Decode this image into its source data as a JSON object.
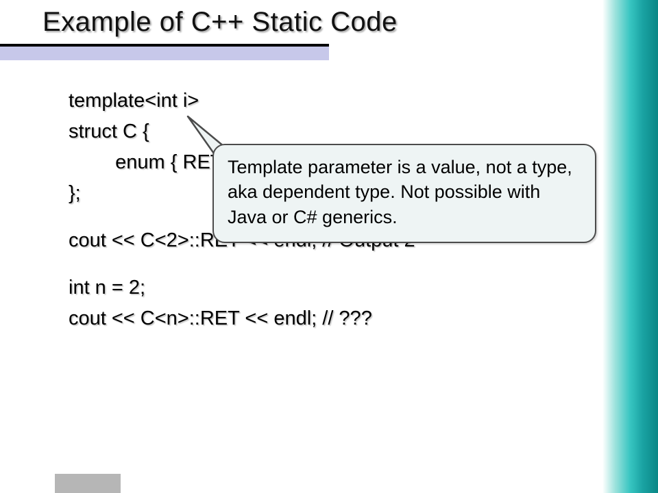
{
  "title": "Example of C++ Static Code",
  "code": {
    "l1": "template<int i>",
    "l2": "struct C {",
    "l3": "   enum { RET = i };",
    "l4": "};",
    "l5": "cout << C<2>::RET << endl; // Output 2",
    "l6": "int n = 2;",
    "l7": "cout << C<n>::RET << endl; // ???"
  },
  "callout": "Template parameter is a value, not a type, aka dependent type. Not possible with Java or C# generics."
}
